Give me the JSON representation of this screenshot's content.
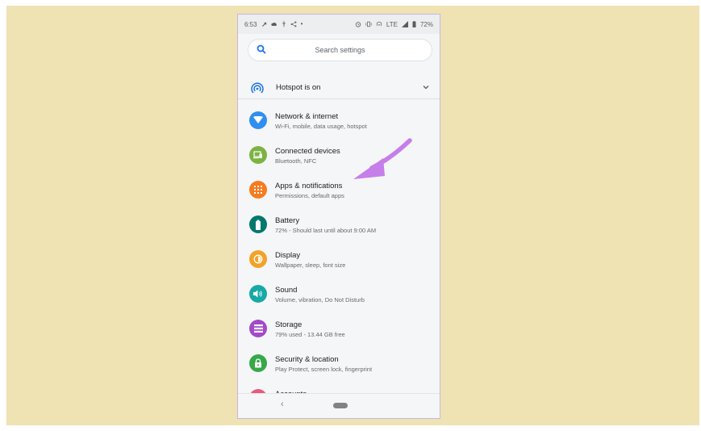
{
  "status_bar": {
    "time": "6:53",
    "network": "LTE",
    "battery": "72%"
  },
  "search": {
    "placeholder": "Search settings"
  },
  "hotspot": {
    "label": "Hotspot is on"
  },
  "settings": [
    {
      "title": "Network & internet",
      "subtitle": "Wi-Fi, mobile, data usage, hotspot",
      "icon": "wifi-icon",
      "color": "#2f8ff0"
    },
    {
      "title": "Connected devices",
      "subtitle": "Bluetooth, NFC",
      "icon": "devices-icon",
      "color": "#7cb342"
    },
    {
      "title": "Apps & notifications",
      "subtitle": "Permissions, default apps",
      "icon": "apps-grid-icon",
      "color": "#f57c1f"
    },
    {
      "title": "Battery",
      "subtitle": "72% - Should last until about 9:00 AM",
      "icon": "battery-icon",
      "color": "#00796b"
    },
    {
      "title": "Display",
      "subtitle": "Wallpaper, sleep, font size",
      "icon": "brightness-icon",
      "color": "#f2a227"
    },
    {
      "title": "Sound",
      "subtitle": "Volume, vibration, Do Not Disturb",
      "icon": "volume-icon",
      "color": "#17a9a6"
    },
    {
      "title": "Storage",
      "subtitle": "79% used - 13.44 GB free",
      "icon": "storage-icon",
      "color": "#a349c9"
    },
    {
      "title": "Security & location",
      "subtitle": "Play Protect, screen lock, fingerprint",
      "icon": "lock-icon",
      "color": "#37a84a"
    },
    {
      "title": "Accounts",
      "subtitle": "",
      "icon": "account-icon",
      "color": "#e95a7e"
    }
  ],
  "annotation": {
    "arrow_color": "#c67ee9"
  }
}
